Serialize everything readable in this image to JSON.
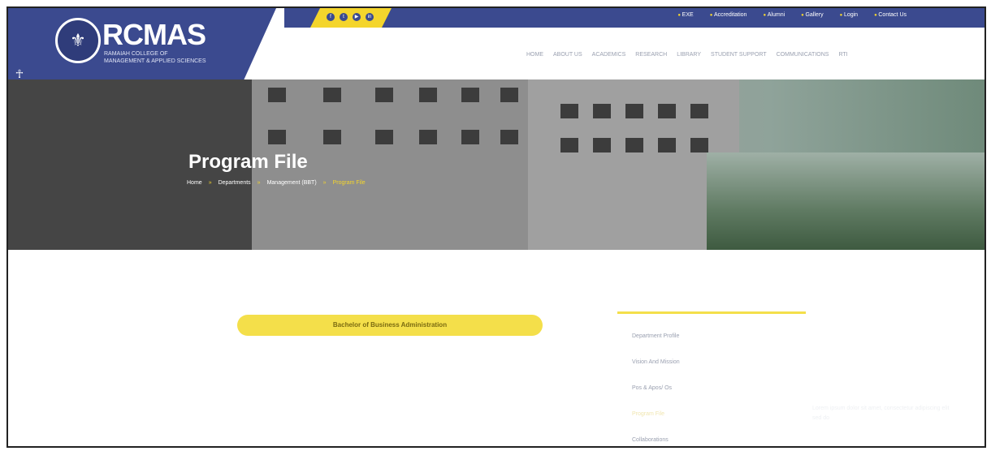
{
  "header": {
    "logo_text": "RCMAS",
    "logo_subtitle": "RAMAIAH COLLEGE OF MANAGEMENT & APPLIED SCIENCES",
    "top_links": [
      "EXE",
      "Accreditation",
      "Alumni",
      "Gallery",
      "Login",
      "Contact Us"
    ],
    "main_nav": [
      "HOME",
      "ABOUT US",
      "ACADEMICS",
      "RESEARCH",
      "LIBRARY",
      "STUDENT SUPPORT",
      "COMMUNICATIONS",
      "RTI"
    ]
  },
  "banner": {
    "title": "Program File",
    "breadcrumb": [
      "Home",
      "Departments",
      "Management (BBT)",
      "Program File"
    ],
    "breadcrumb_separator": "»"
  },
  "content": {
    "program_button": "Bachelor of Business Administration",
    "side_menu": [
      "Department Profile",
      "Vision And Mission",
      "Pos & Apos/ Os",
      "Program File",
      "Collaborations"
    ],
    "side_note": "Lorem ipsum dolor sit amet, consectetur adipiscing elit sed do"
  },
  "colors": {
    "brand_blue": "#3b4a8f",
    "accent_yellow": "#f4d52c"
  }
}
